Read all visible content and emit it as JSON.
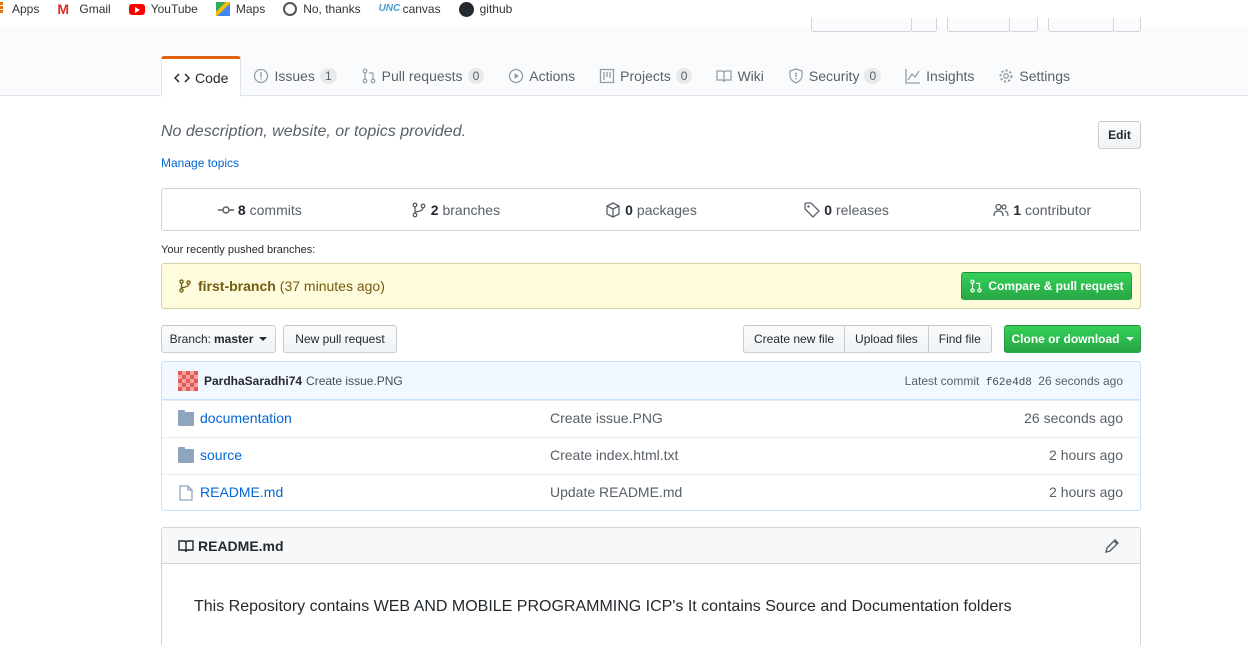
{
  "bookmarks": {
    "items": [
      {
        "label": "Apps",
        "icon": "apps-grid-icon"
      },
      {
        "label": "Gmail",
        "icon": "gmail-icon"
      },
      {
        "label": "YouTube",
        "icon": "youtube-icon"
      },
      {
        "label": "Maps",
        "icon": "maps-icon"
      },
      {
        "label": "No, thanks",
        "icon": "globe-icon"
      },
      {
        "label": "canvas",
        "icon": "unc-icon"
      },
      {
        "label": "github",
        "icon": "github-icon"
      }
    ]
  },
  "tabs": [
    {
      "label": "Code",
      "icon": "code-icon",
      "selected": true
    },
    {
      "label": "Issues",
      "icon": "issue-icon",
      "count": "1"
    },
    {
      "label": "Pull requests",
      "icon": "pull-request-icon",
      "count": "0"
    },
    {
      "label": "Actions",
      "icon": "play-icon"
    },
    {
      "label": "Projects",
      "icon": "project-icon",
      "count": "0"
    },
    {
      "label": "Wiki",
      "icon": "book-icon"
    },
    {
      "label": "Security",
      "icon": "shield-icon",
      "count": "0"
    },
    {
      "label": "Insights",
      "icon": "graph-icon"
    },
    {
      "label": "Settings",
      "icon": "gear-icon"
    }
  ],
  "repo": {
    "description": "No description, website, or topics provided.",
    "manage_topics": "Manage topics",
    "edit_label": "Edit"
  },
  "numbers": [
    {
      "count": "8",
      "label": "commits",
      "icon": "commit-icon"
    },
    {
      "count": "2",
      "label": "branches",
      "icon": "branch-icon"
    },
    {
      "count": "0",
      "label": "packages",
      "icon": "package-icon"
    },
    {
      "count": "0",
      "label": "releases",
      "icon": "tag-icon"
    },
    {
      "count": "1",
      "label": "contributor",
      "icon": "people-icon"
    }
  ],
  "recent": {
    "label": "Your recently pushed branches:",
    "branch": "first-branch",
    "ago": "(37 minutes ago)",
    "compare_label": "Compare & pull request"
  },
  "toolbar": {
    "branch_prefix": "Branch:",
    "branch_name": "master",
    "new_pr": "New pull request",
    "create_file": "Create new file",
    "upload": "Upload files",
    "find": "Find file",
    "clone": "Clone or download"
  },
  "commit": {
    "author": "PardhaSaradhi74",
    "message": "Create issue.PNG",
    "latest_label": "Latest commit",
    "sha": "f62e4d8",
    "age": "26 seconds ago"
  },
  "files": [
    {
      "name": "documentation",
      "type": "folder",
      "message": "Create issue.PNG",
      "age": "26 seconds ago"
    },
    {
      "name": "source",
      "type": "folder",
      "message": "Create index.html.txt",
      "age": "2 hours ago"
    },
    {
      "name": "README.md",
      "type": "file",
      "message": "Update README.md",
      "age": "2 hours ago"
    }
  ],
  "readme": {
    "title": "README.md",
    "body": "This Repository contains WEB AND MOBILE PROGRAMMING ICP's It contains Source and Documentation folders"
  }
}
